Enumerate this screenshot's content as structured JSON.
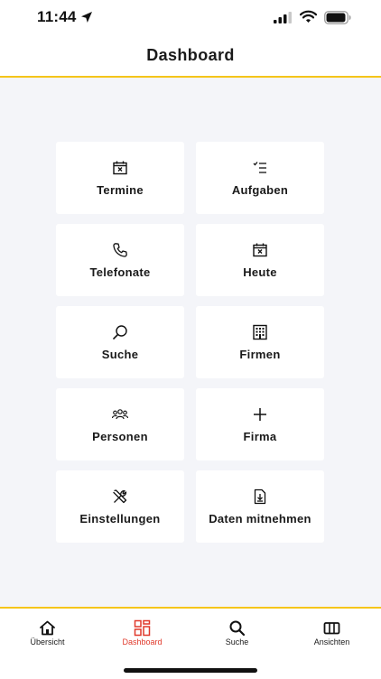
{
  "status_bar": {
    "time": "11:44"
  },
  "header": {
    "title": "Dashboard"
  },
  "tiles": [
    {
      "label": "Termine",
      "icon": "calendar-x-icon"
    },
    {
      "label": "Aufgaben",
      "icon": "checklist-icon"
    },
    {
      "label": "Telefonate",
      "icon": "phone-icon"
    },
    {
      "label": "Heute",
      "icon": "calendar-x-icon"
    },
    {
      "label": "Suche",
      "icon": "search-icon"
    },
    {
      "label": "Firmen",
      "icon": "building-icon"
    },
    {
      "label": "Personen",
      "icon": "people-icon"
    },
    {
      "label": "Firma",
      "icon": "plus-icon"
    },
    {
      "label": "Einstellungen",
      "icon": "tools-icon"
    },
    {
      "label": "Daten mitnehmen",
      "icon": "download-document-icon"
    }
  ],
  "tabbar": {
    "active_color": "#e0392b",
    "accent_color": "#f5c51a",
    "items": [
      {
        "label": "Übersicht",
        "icon": "home-icon",
        "active": false
      },
      {
        "label": "Dashboard",
        "icon": "dashboard-grid-icon",
        "active": true
      },
      {
        "label": "Suche",
        "icon": "search-icon",
        "active": false
      },
      {
        "label": "Ansichten",
        "icon": "columns-icon",
        "active": false
      }
    ]
  }
}
